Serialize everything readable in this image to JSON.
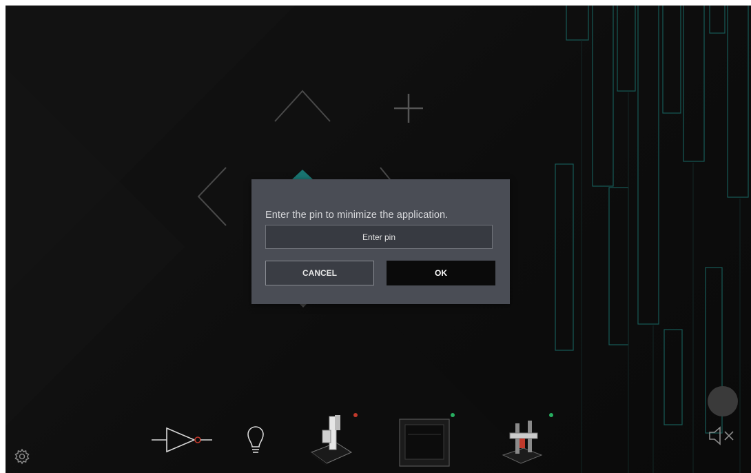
{
  "dialog": {
    "message": "Enter the pin to minimize the application.",
    "pin_placeholder": "Enter pin",
    "cancel_label": "CANCEL",
    "ok_label": "OK"
  },
  "colors": {
    "accent_teal": "#1f8f8a",
    "status_red": "#c0392b",
    "status_green": "#27ae60",
    "dialog_bg": "#4a4d55"
  },
  "toolbar": {
    "items": [
      {
        "icon": "not-gate-icon"
      },
      {
        "icon": "lightbulb-icon"
      },
      {
        "icon": "laser-engraver-icon",
        "status": "red"
      },
      {
        "icon": "3d-printer-icon",
        "status": "green"
      },
      {
        "icon": "cnc-machine-icon",
        "status": "green"
      }
    ]
  },
  "icons": {
    "settings": "gear-icon",
    "mute": "speaker-muted-icon",
    "record": "record-button"
  }
}
